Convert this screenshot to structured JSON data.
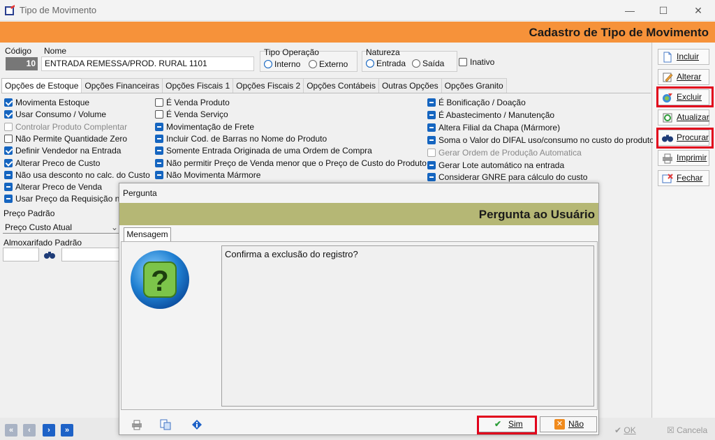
{
  "window": {
    "title": "Tipo de Movimento",
    "minimize": "—",
    "maximize": "☐",
    "close": "✕"
  },
  "header": {
    "heading": "Cadastro de Tipo de Movimento"
  },
  "form": {
    "code_label": "Código",
    "code_value": "10",
    "name_label": "Nome",
    "name_value": "ENTRADA REMESSA/PROD. RURAL 1101",
    "tipo_operacao": {
      "label": "Tipo Operação",
      "options": [
        "Interno",
        "Externo"
      ],
      "selected": "Interno"
    },
    "natureza": {
      "label": "Natureza",
      "options": [
        "Entrada",
        "Saída"
      ],
      "selected": "Entrada"
    },
    "inativo_label": "Inativo"
  },
  "tabs": [
    "Opções de Estoque",
    "Opções Financeiras",
    "Opções Fiscais 1",
    "Opções Fiscais 2",
    "Opções Contábeis",
    "Outras Opções",
    "Opções Granito"
  ],
  "options_col1": [
    {
      "label": "Movimenta Estoque",
      "state": "checked"
    },
    {
      "label": "Usar Consumo / Volume",
      "state": "checked"
    },
    {
      "label": "Controlar Produto Complentar",
      "state": "disabled"
    },
    {
      "label": "Não Permite Quantidade Zero",
      "state": "empty"
    },
    {
      "label": "Definir Vendedor na Entrada",
      "state": "checked"
    },
    {
      "label": "Alterar Preco de Custo",
      "state": "checked"
    },
    {
      "label": "Não usa desconto no calc. do Custo",
      "state": "indet"
    },
    {
      "label": "Alterar Preco de Venda",
      "state": "indet"
    },
    {
      "label": "Usar Preço da Requisição na",
      "state": "indet"
    }
  ],
  "options_col2": [
    {
      "label": "É Venda Produto",
      "state": "empty"
    },
    {
      "label": "É Venda Serviço",
      "state": "empty"
    },
    {
      "label": "Movimentação de Frete",
      "state": "indet"
    },
    {
      "label": "Incluir Cod. de Barras no Nome do Produto",
      "state": "indet"
    },
    {
      "label": "Somente Entrada Originada de uma Ordem de Compra",
      "state": "indet"
    },
    {
      "label": "Não permitir Preço de Venda menor que o Preço de Custo do Produto",
      "state": "indet"
    },
    {
      "label": "Não Movimenta Mármore",
      "state": "indet"
    }
  ],
  "options_col3": [
    {
      "label": "É Bonificação / Doação",
      "state": "indet"
    },
    {
      "label": "É Abastecimento / Manutenção",
      "state": "indet"
    },
    {
      "label": "Altera Filial da Chapa (Mármore)",
      "state": "indet"
    },
    {
      "label": "Soma o Valor do DIFAL uso/consumo no custo do produto",
      "state": "indet"
    },
    {
      "label": "Gerar Ordem de Produção Automatica",
      "state": "disabled"
    },
    {
      "label": "Gerar Lote automático na entrada",
      "state": "indet"
    },
    {
      "label": "Considerar GNRE para cálculo do custo",
      "state": "indet"
    }
  ],
  "preco_padrao": {
    "label": "Preço Padrão",
    "value": "Preço Custo Atual"
  },
  "almox": {
    "label": "Almoxarifado Padrão"
  },
  "toolbar": {
    "incluir": "Incluir",
    "alterar": "Alterar",
    "excluir": "Excluir",
    "atualizar": "Atualizar",
    "procurar": "Procurar",
    "imprimir": "Imprimir",
    "fechar": "Fechar"
  },
  "bottom": {
    "ok": "OK",
    "cancela": "Cancela"
  },
  "dialog": {
    "title": "Pergunta",
    "banner": "Pergunta ao Usuário",
    "tab": "Mensagem",
    "message": "Confirma a exclusão do registro?",
    "yes": "Sim",
    "no": "Não"
  },
  "colors": {
    "orange": "#f6923a",
    "highlight": "#e1001b",
    "banner": "#b5b775",
    "accent": "#1565c0"
  }
}
